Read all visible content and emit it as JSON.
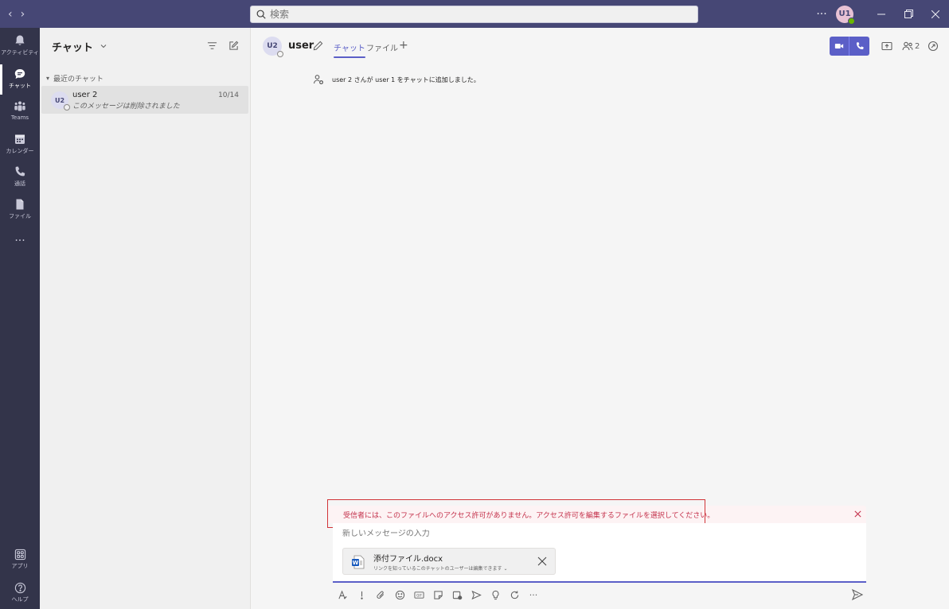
{
  "titlebar": {
    "search_placeholder": "検索",
    "more": "···",
    "user_initials": "U1"
  },
  "rail": {
    "items": [
      {
        "label": "アクティビティ",
        "icon": "bell-icon"
      },
      {
        "label": "チャット",
        "icon": "chat-icon"
      },
      {
        "label": "Teams",
        "icon": "teams-icon"
      },
      {
        "label": "カレンダー",
        "icon": "calendar-icon"
      },
      {
        "label": "通話",
        "icon": "phone-icon"
      },
      {
        "label": "ファイル",
        "icon": "file-icon"
      },
      {
        "label": "···",
        "icon": "more-icon"
      }
    ],
    "bottom": [
      {
        "label": "アプリ",
        "icon": "apps-icon"
      },
      {
        "label": "ヘルプ",
        "icon": "help-icon"
      }
    ]
  },
  "chatlist": {
    "title": "チャット",
    "section": "最近のチャット",
    "items": [
      {
        "initials": "U2",
        "name": "user 2",
        "preview": "このメッセージは削除されました",
        "date": "10/14"
      }
    ]
  },
  "main": {
    "avatar": "U2",
    "name": "user",
    "tabs": [
      "チャット",
      "ファイル"
    ],
    "participants": "2",
    "system_message": "user 2 さんが user 1 をチャットに追加しました。"
  },
  "compose": {
    "error": "受信者には、このファイルへのアクセス許可がありません。アクセス許可を編集するファイルを選択してください。",
    "placeholder": "新しいメッセージの入力",
    "attachment": {
      "name": "添付ファイル.docx",
      "sub": "リンクを知っているこのチャットのユーザーは編集できます",
      "type_label": "W"
    }
  },
  "colors": {
    "titlebar": "#464775",
    "rail": "#33344a",
    "accent": "#5b5fc7",
    "error": "#c4314b"
  }
}
